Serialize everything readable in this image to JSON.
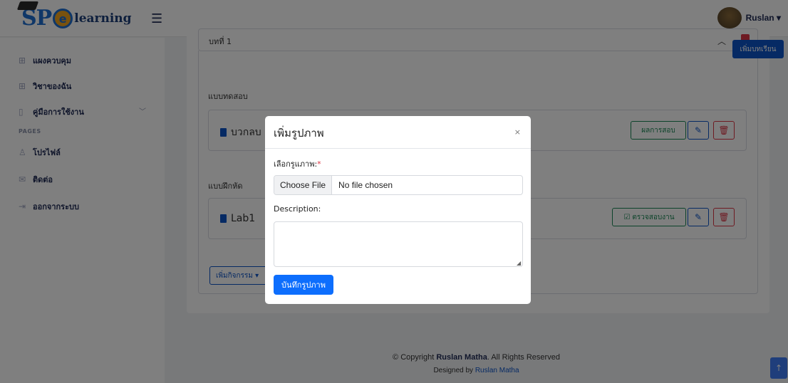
{
  "header": {
    "logo_sp": "SP",
    "logo_e": "e",
    "logo_learning": "learning",
    "menu_icon": "☰",
    "user_name": "Ruslan ▾"
  },
  "sidebar": {
    "items": [
      {
        "label": "แผงควบคุม",
        "icon": "grid-icon",
        "glyph": "⊞"
      },
      {
        "label": "วิชาของฉัน",
        "icon": "grid-icon",
        "glyph": "⊞"
      },
      {
        "label": "คู่มือการใช้งาน",
        "icon": "book-icon",
        "glyph": "▯"
      },
      {
        "label": "โปรไฟล์",
        "icon": "person-icon",
        "glyph": "♙"
      },
      {
        "label": "ติดต่อ",
        "icon": "envelope-icon",
        "glyph": "✉"
      },
      {
        "label": "ออกจากระบบ",
        "icon": "logout-icon",
        "glyph": "⇥"
      }
    ],
    "section_heading": "PAGES",
    "chevron": "﹀"
  },
  "lesson": {
    "title": "บทที่ 1",
    "caret": "︿",
    "add_lesson_label": "เพิ่มบทเรียน"
  },
  "sections": {
    "quiz_label": "แบบทดสอบ",
    "exercise_label": "แบบฝึกหัด"
  },
  "activities": {
    "quiz": {
      "name": "บวกลบ",
      "result_label": "ผลการสอบ"
    },
    "exercise": {
      "name": "Lab1",
      "check_label": "ตรวจสอบงาน"
    }
  },
  "add_activity_label": "เพิ่มกิจกรรม ▾",
  "footer": {
    "copyright_prefix": "© Copyright ",
    "copyright_name": "Ruslan Matha",
    "copyright_suffix": ". All Rights Reserved",
    "designed_prefix": "Designed by ",
    "designed_name": "Ruslan Matha"
  },
  "back_to_top": "↑",
  "modal": {
    "title": "เพิ่มรูปภาพ",
    "close": "×",
    "image_label": "เลือกรูแภาพ:",
    "required_mark": "*",
    "file_button": "Choose File",
    "file_status": "No file chosen",
    "description_label": "Description:",
    "description_value": "",
    "save_label": "บันทึกรูปภาพ"
  },
  "colors": {
    "primary": "#0d6efd",
    "success": "#198754",
    "danger": "#dc3545",
    "navy": "#1f2a55"
  }
}
